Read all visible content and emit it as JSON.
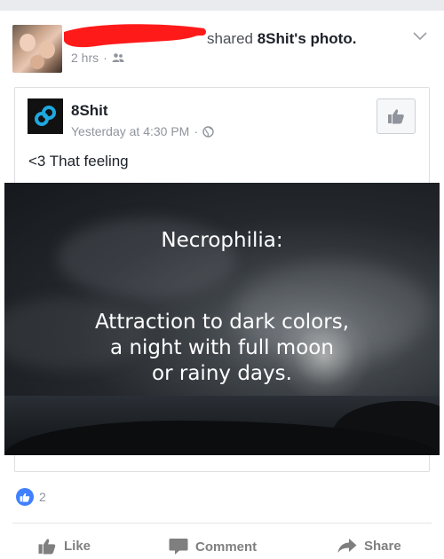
{
  "post": {
    "action_text": "shared",
    "shared_page_possessive": "8Shit's",
    "shared_object": "photo.",
    "time": "2 hrs",
    "separator": "·",
    "audience_icon": "friends-icon"
  },
  "shared_post": {
    "page_name": "8Shit",
    "timestamp": "Yesterday at 4:30 PM",
    "separator": "·",
    "audience_icon": "globe-icon",
    "caption": "<3 That feeling",
    "photo": {
      "title": "Necrophilia:",
      "lines": [
        "Attraction to dark colors,",
        "a night with full moon",
        "or rainy days."
      ]
    }
  },
  "reactions": {
    "count": "2",
    "icon": "like-reaction-icon"
  },
  "actions": {
    "like": "Like",
    "comment": "Comment",
    "share": "Share"
  },
  "colors": {
    "accent": "#4080ff",
    "redaction": "#ff1a1a",
    "logo_blue": "#1fa8e0"
  }
}
